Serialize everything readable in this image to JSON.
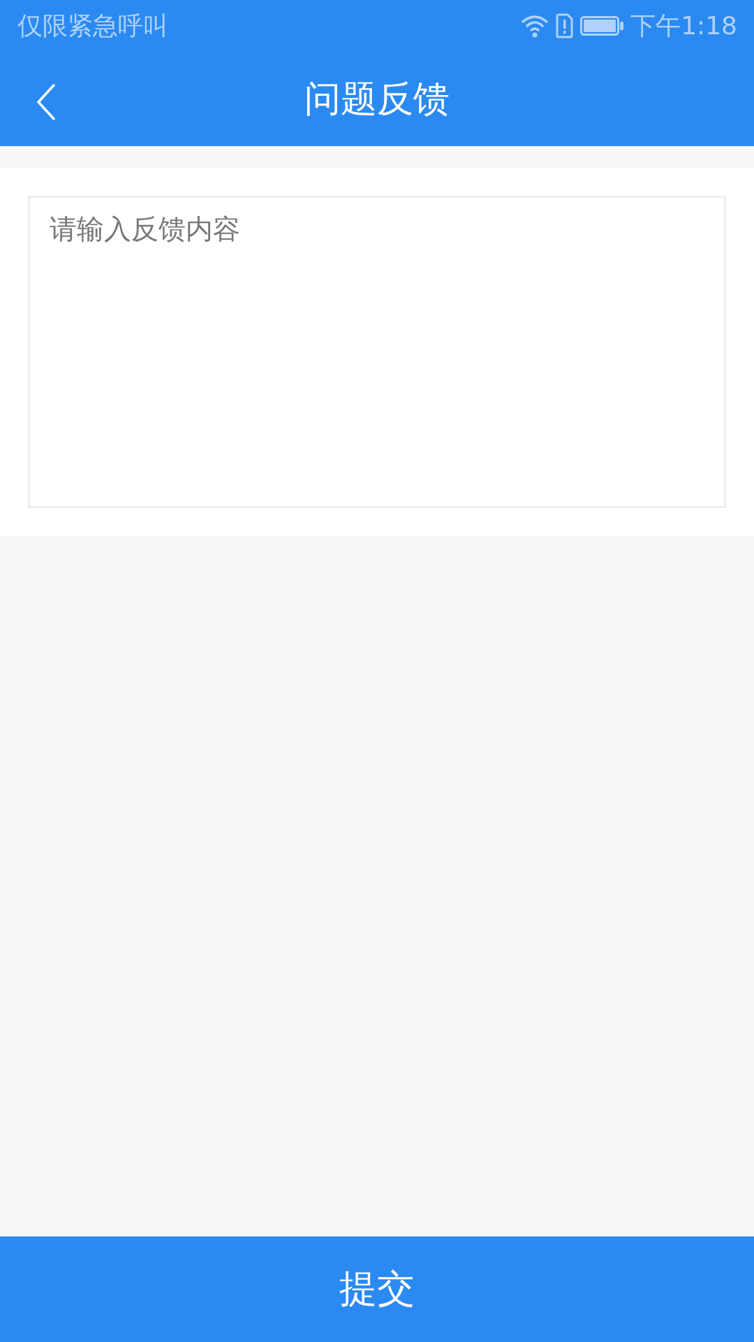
{
  "status_bar": {
    "carrier": "仅限紧急呼叫",
    "time": "下午1:18"
  },
  "header": {
    "title": "问题反馈"
  },
  "feedback": {
    "placeholder": "请输入反馈内容"
  },
  "submit_button": {
    "label": "提交"
  }
}
